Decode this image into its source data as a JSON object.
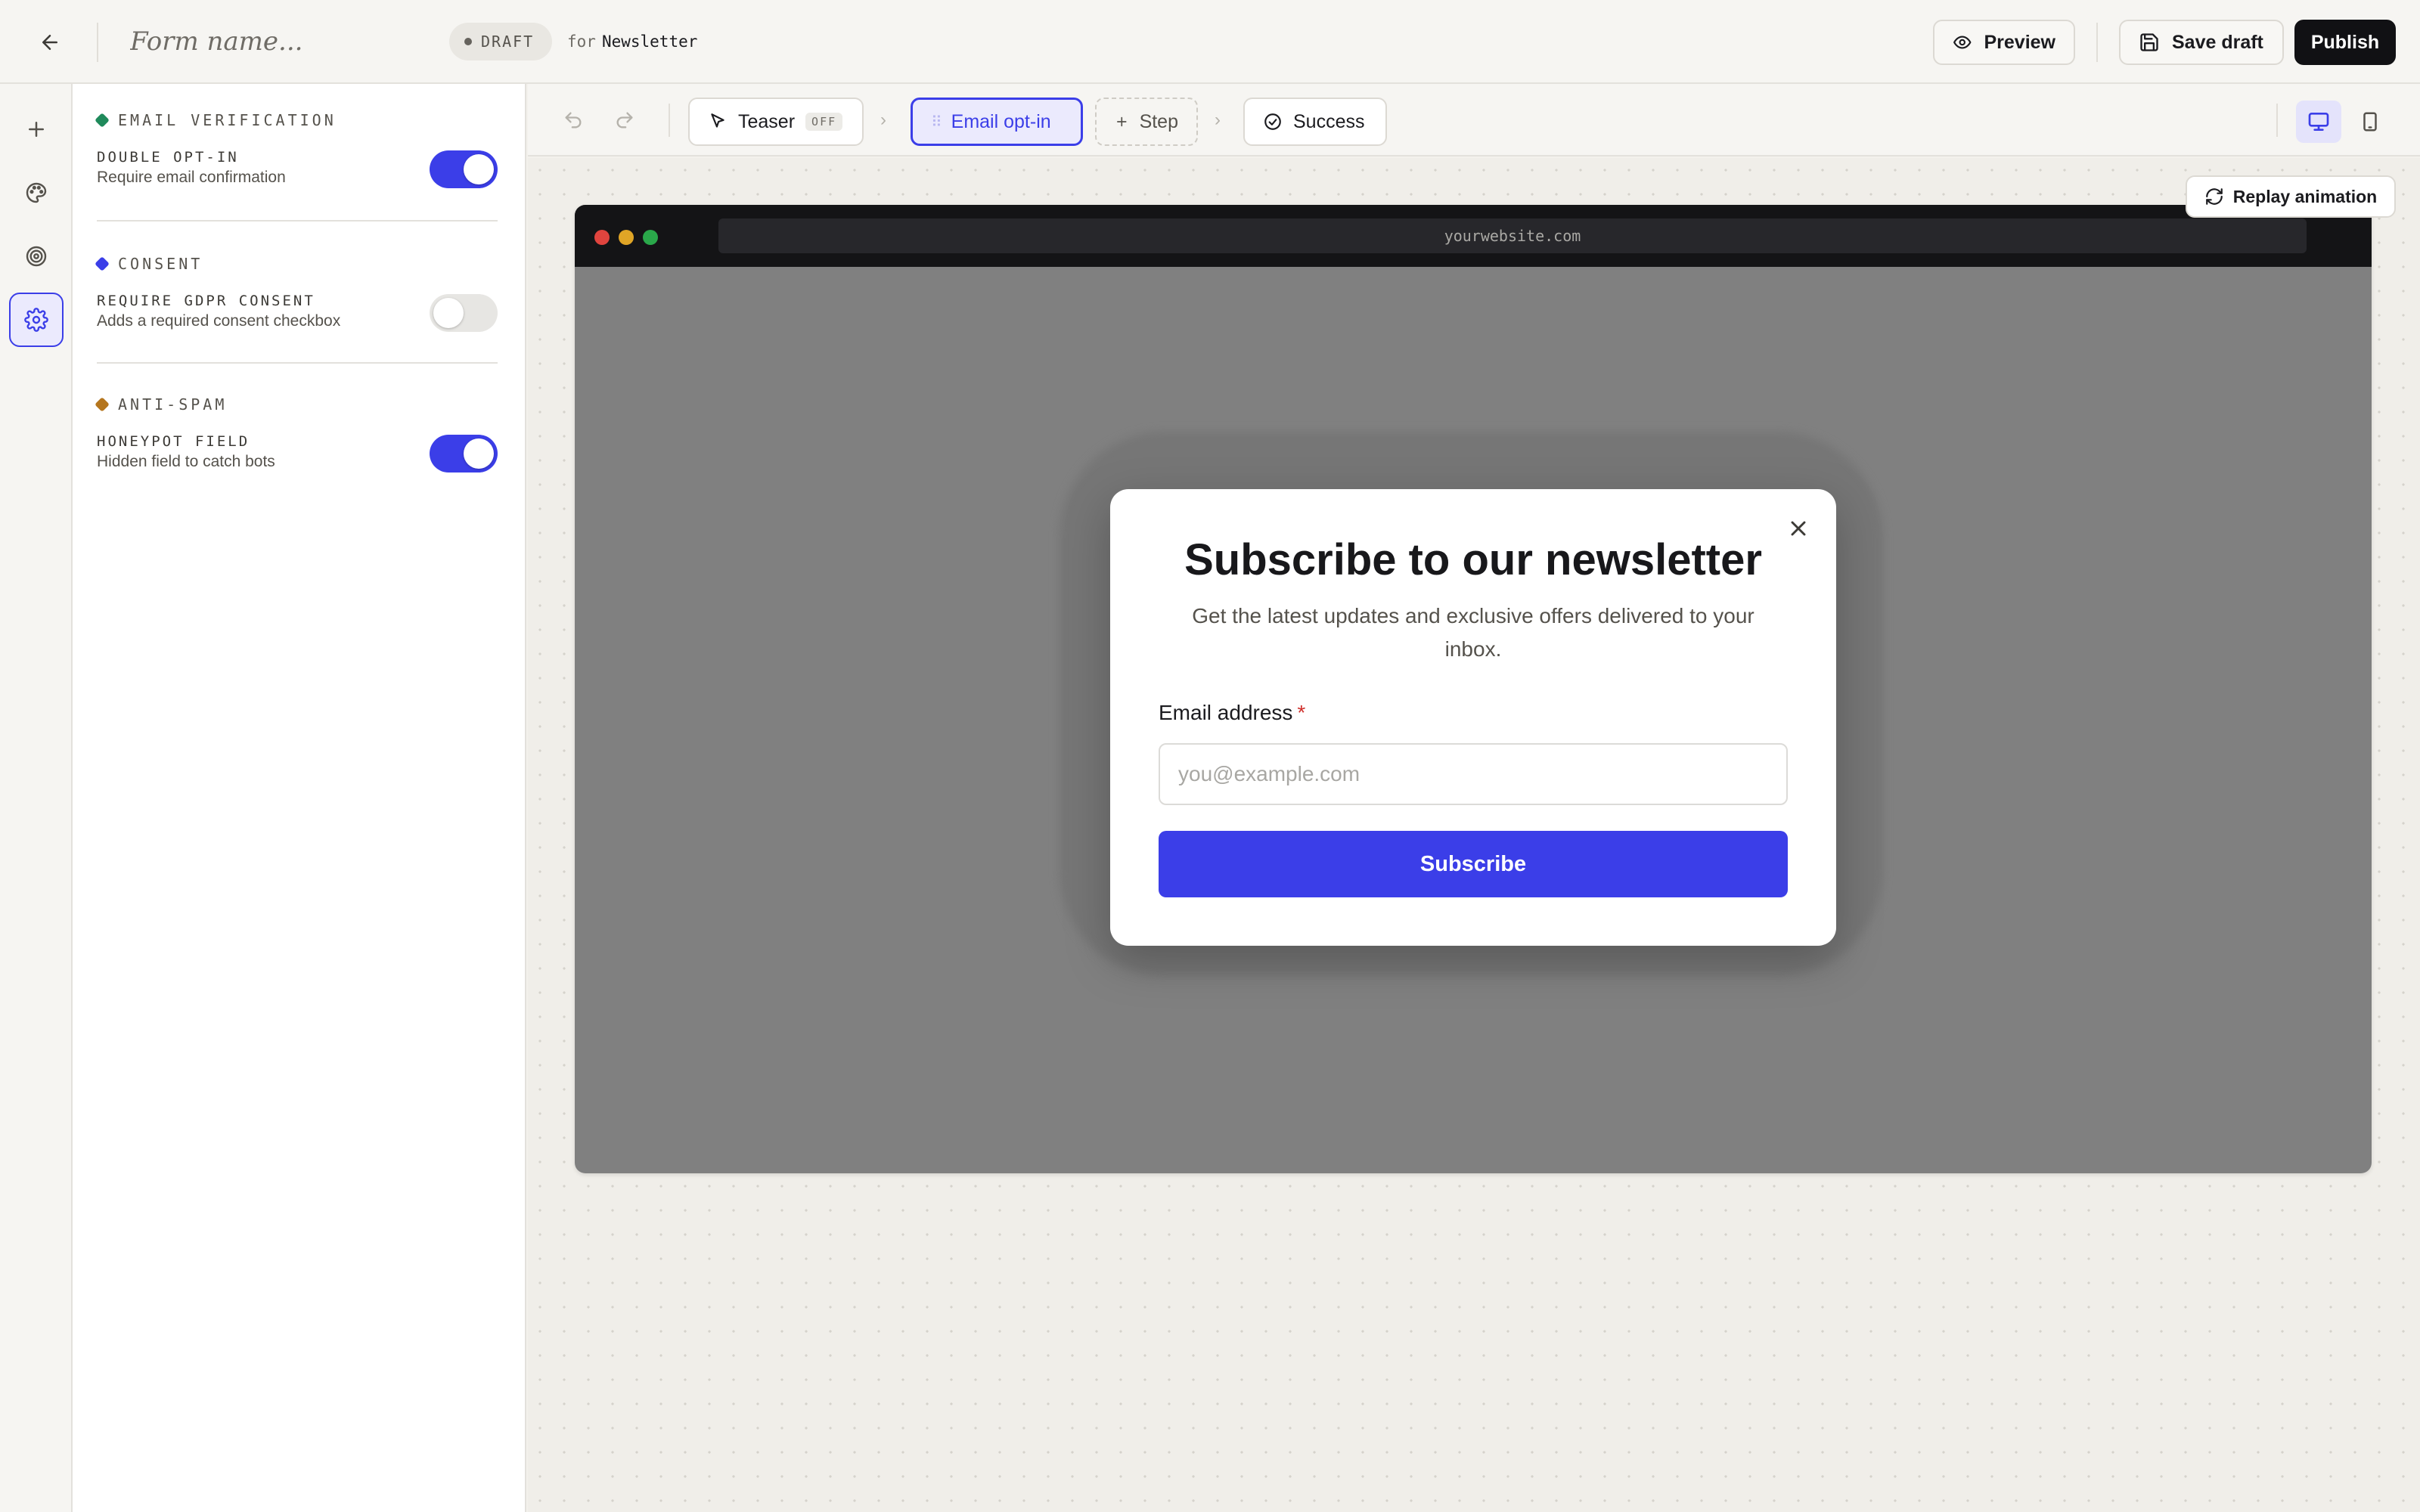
{
  "header": {
    "form_name_placeholder": "Form name...",
    "status_badge": "DRAFT",
    "for_label": "for",
    "target_name": "Newsletter",
    "preview_label": "Preview",
    "save_draft_label": "Save draft",
    "publish_label": "Publish"
  },
  "rail": {
    "items": [
      {
        "icon": "plus-icon",
        "active": false
      },
      {
        "icon": "palette-icon",
        "active": false
      },
      {
        "icon": "target-icon",
        "active": false
      },
      {
        "icon": "gear-icon",
        "active": true
      }
    ]
  },
  "settings": {
    "sections": [
      {
        "title": "EMAIL VERIFICATION",
        "dot_color": "#1f8a5b",
        "setting": {
          "title": "DOUBLE OPT-IN",
          "description": "Require email confirmation",
          "enabled": true
        }
      },
      {
        "title": "CONSENT",
        "dot_color": "#3b3ee8",
        "setting": {
          "title": "REQUIRE GDPR CONSENT",
          "description": "Adds a required consent checkbox",
          "enabled": false
        }
      },
      {
        "title": "ANTI-SPAM",
        "dot_color": "#b5761e",
        "setting": {
          "title": "HONEYPOT FIELD",
          "description": "Hidden field to catch bots",
          "enabled": true
        }
      }
    ]
  },
  "steps": {
    "teaser": {
      "label": "Teaser",
      "badge": "OFF"
    },
    "email_optin": {
      "label": "Email opt-in",
      "active": true
    },
    "add_step": {
      "label": "Step"
    },
    "success": {
      "label": "Success"
    }
  },
  "canvas": {
    "replay_label": "Replay animation",
    "url": "yourwebsite.com",
    "device": "desktop"
  },
  "modal": {
    "title": "Subscribe to our newsletter",
    "subtitle": "Get the latest updates and exclusive offers delivered to your inbox.",
    "email_label": "Email address",
    "required_mark": "*",
    "email_placeholder": "you@example.com",
    "email_value": "",
    "button_label": "Subscribe"
  },
  "colors": {
    "accent": "#3b3ee8",
    "publish_bg": "#111114",
    "overlay": "#808080",
    "browser_chrome": "#141416",
    "traffic_red": "#e0443e",
    "traffic_yellow": "#e0a526",
    "traffic_green": "#2aa84a"
  }
}
